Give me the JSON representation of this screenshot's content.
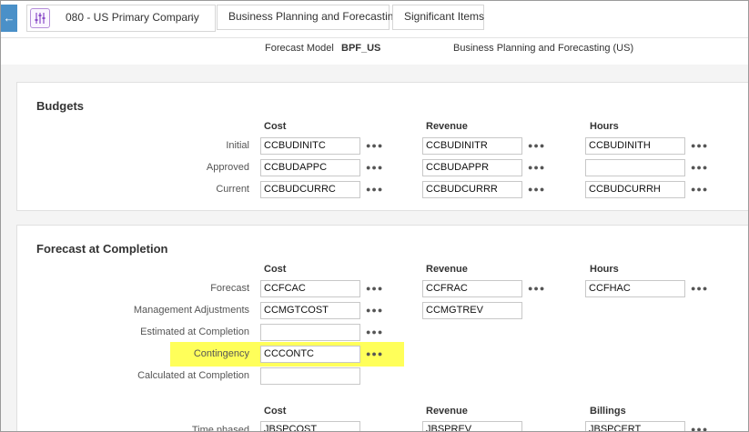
{
  "breadcrumb": {
    "company": "080 - US Primary Company",
    "items": [
      "Business Planning and Forecasting",
      "Significant Items"
    ]
  },
  "model": {
    "label": "Forecast Model",
    "value": "BPF_US",
    "description": "Business Planning and Forecasting (US)"
  },
  "budgets": {
    "title": "Budgets",
    "columns": [
      "Cost",
      "Revenue",
      "Hours"
    ],
    "rows": [
      {
        "label": "Initial",
        "cost": "CCBUDINITC",
        "revenue": "CCBUDINITR",
        "hours": "CCBUDINITH"
      },
      {
        "label": "Approved",
        "cost": "CCBUDAPPC",
        "revenue": "CCBUDAPPR",
        "hours": ""
      },
      {
        "label": "Current",
        "cost": "CCBUDCURRC",
        "revenue": "CCBUDCURRR",
        "hours": "CCBUDCURRH"
      }
    ]
  },
  "fac": {
    "title": "Forecast at Completion",
    "columns": [
      "Cost",
      "Revenue",
      "Hours"
    ],
    "rows": [
      {
        "label": "Forecast",
        "cost": "CCFCAC",
        "revenue": "CCFRAC",
        "hours": "CCFHAC"
      },
      {
        "label": "Management Adjustments",
        "cost": "CCMGTCOST",
        "revenue": "CCMGTREV"
      },
      {
        "label": "Estimated at Completion",
        "cost": ""
      },
      {
        "label": "Contingency",
        "cost": "CCCONTC"
      },
      {
        "label": "Calculated at Completion",
        "cost": ""
      }
    ],
    "columns2": [
      "Cost",
      "Revenue",
      "Billings"
    ],
    "row_time": {
      "label": "Time phased",
      "cost": "JBSPCOST",
      "revenue": "JBSPREV",
      "billings": "JBSPCERT"
    }
  },
  "colors": {
    "highlight": "#ffff5a",
    "back_button": "#4a90c8",
    "accent": "#8a4bc7"
  },
  "icons": {
    "back": "arrow-left-icon",
    "settings": "sliders-icon",
    "sort": "arrow-down-icon",
    "more": "ellipsis-icon"
  }
}
